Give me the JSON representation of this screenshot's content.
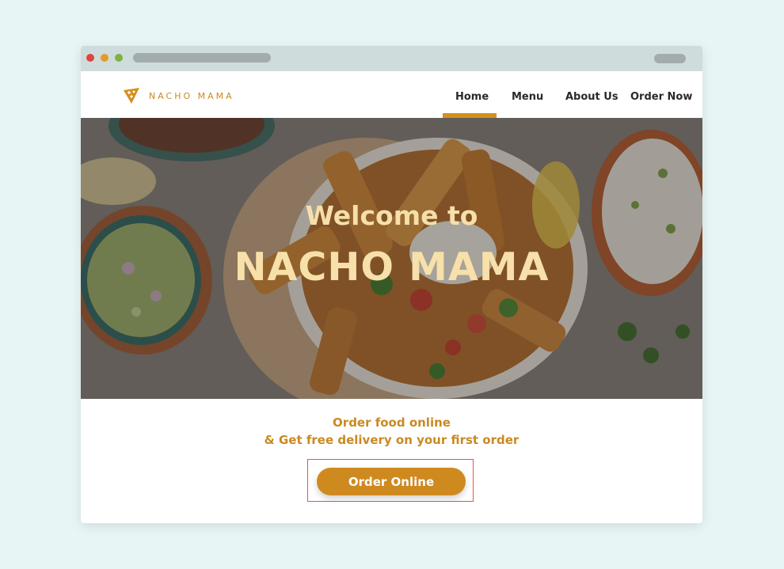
{
  "brand": {
    "name": "NACHO MAMA",
    "accent": "#d4901e",
    "logo_icon": "nacho-chip-icon"
  },
  "nav": {
    "items": [
      {
        "label": "Home",
        "active": true
      },
      {
        "label": "Menu",
        "active": false
      },
      {
        "label": "About Us",
        "active": false
      },
      {
        "label": "Order Now",
        "active": false
      }
    ]
  },
  "hero": {
    "subtitle": "Welcome to",
    "title": "NACHO MAMA",
    "text_color": "#f6dfa9"
  },
  "promo": {
    "line1": "Order food online",
    "line2": "& Get free delivery on your first order"
  },
  "cta": {
    "label": "Order Online",
    "color": "#cf8a1f",
    "highlight_color": "#e2574c"
  }
}
